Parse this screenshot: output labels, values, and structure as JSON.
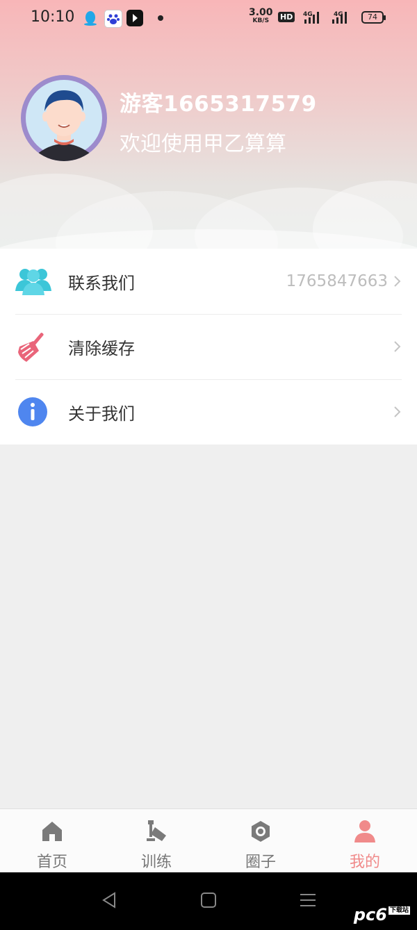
{
  "status": {
    "time": "10:10",
    "speed_value": "3.00",
    "speed_unit": "KB/S",
    "hd": "HD",
    "net1": "4G",
    "net2": "4G",
    "battery": "74"
  },
  "profile": {
    "username": "游客1665317579",
    "welcome": "欢迎使用甲乙算算"
  },
  "menu": [
    {
      "label": "联系我们",
      "value": "1765847663",
      "icon": "contacts-icon"
    },
    {
      "label": "清除缓存",
      "value": "",
      "icon": "broom-icon"
    },
    {
      "label": "关于我们",
      "value": "",
      "icon": "info-icon"
    }
  ],
  "tabs": [
    {
      "label": "首页",
      "icon": "home-icon",
      "active": false
    },
    {
      "label": "训练",
      "icon": "training-icon",
      "active": false
    },
    {
      "label": "圈子",
      "icon": "circle-icon",
      "active": false
    },
    {
      "label": "我的",
      "icon": "profile-icon",
      "active": true
    }
  ],
  "colors": {
    "accent": "#f08a8a",
    "tab_inactive": "#777777",
    "header_top": "#f8b6b8"
  },
  "watermark": {
    "text": "pc6",
    "badge": "下载站"
  }
}
